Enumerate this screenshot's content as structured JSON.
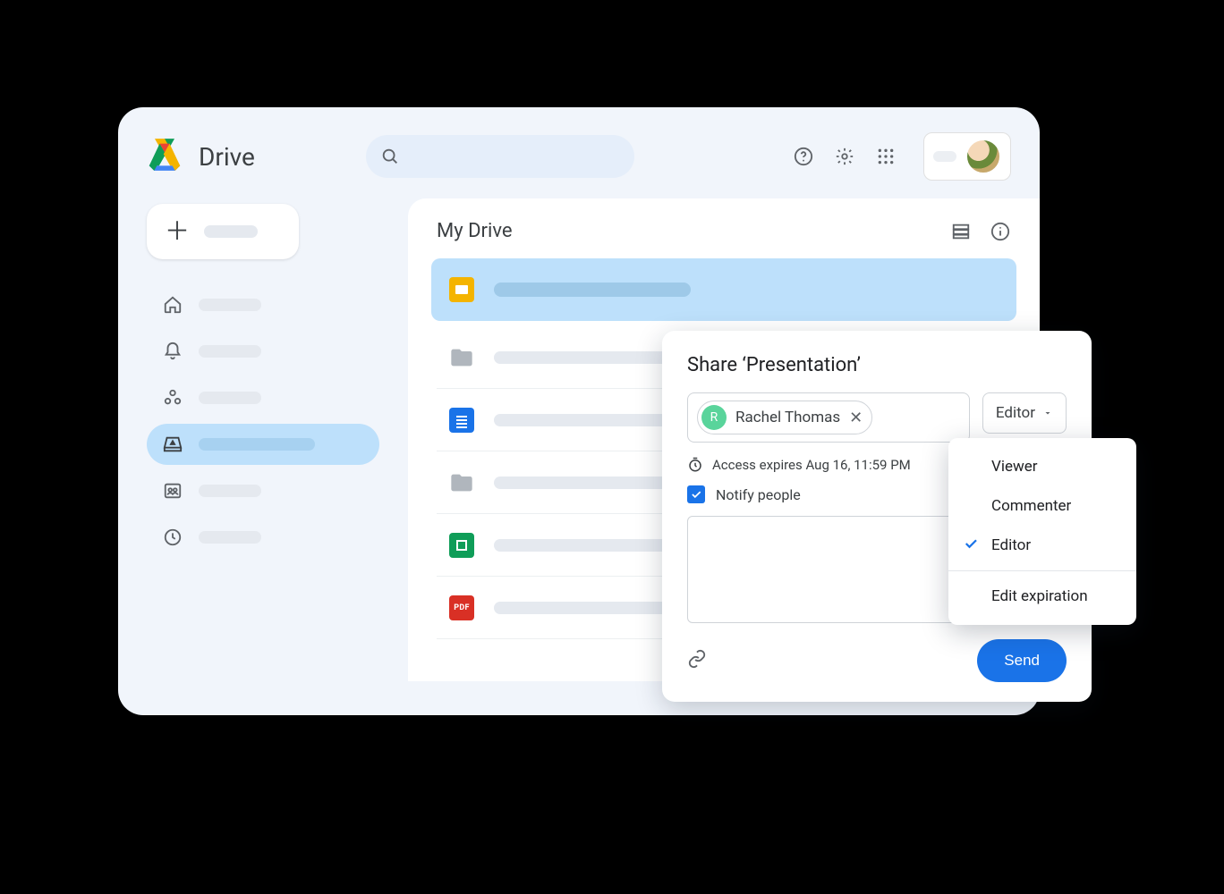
{
  "app": {
    "name": "Drive"
  },
  "header": {
    "icons": {
      "help": "help-icon",
      "settings": "gear-icon",
      "apps": "apps-icon"
    }
  },
  "sidebar": {
    "new_label": "",
    "items": [
      {
        "id": "home",
        "icon": "home-icon"
      },
      {
        "id": "activity",
        "icon": "bell-icon"
      },
      {
        "id": "workspaces",
        "icon": "workspaces-icon"
      },
      {
        "id": "drive",
        "icon": "drive-storage-icon",
        "active": true
      },
      {
        "id": "shared",
        "icon": "shared-drives-icon"
      },
      {
        "id": "recent",
        "icon": "clock-icon"
      }
    ]
  },
  "main": {
    "breadcrumb": "My Drive",
    "files": [
      {
        "type": "slides",
        "selected": true
      },
      {
        "type": "folder"
      },
      {
        "type": "docs"
      },
      {
        "type": "folder"
      },
      {
        "type": "sheets"
      },
      {
        "type": "pdf"
      }
    ]
  },
  "share": {
    "title": "Share ‘Presentation’",
    "person": {
      "name": "Rachel Thomas",
      "initial": "R"
    },
    "role_selected": "Editor",
    "expires": "Access expires Aug 16, 11:59 PM",
    "notify_label": "Notify people",
    "notify_checked": true,
    "send_label": "Send",
    "roles": {
      "options": [
        "Viewer",
        "Commenter",
        "Editor"
      ],
      "selected": "Editor",
      "extra": "Edit expiration"
    }
  }
}
